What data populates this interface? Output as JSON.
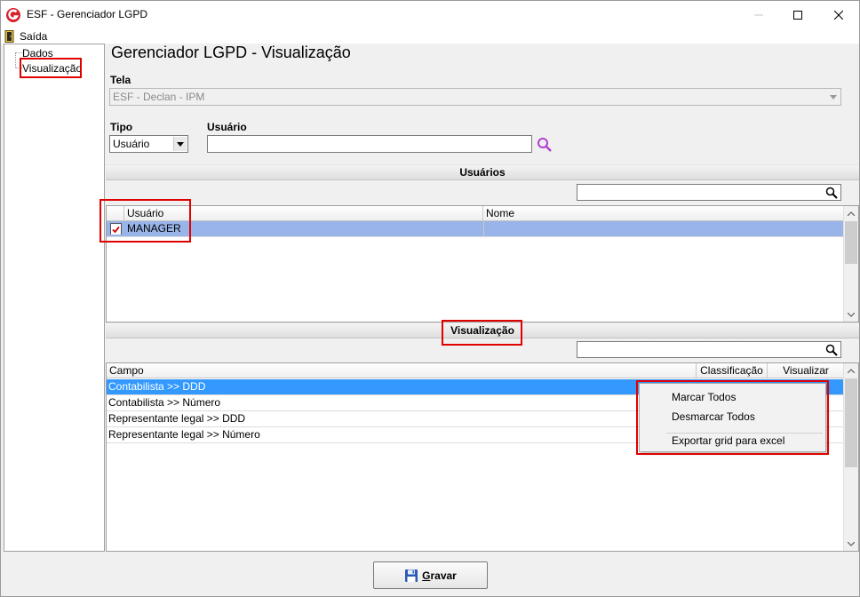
{
  "window": {
    "title": "ESF - Gerenciador LGPD",
    "controls": [
      "minimize",
      "maximize",
      "close"
    ]
  },
  "menu": {
    "items": [
      {
        "label": "Saída",
        "icon": "exit-door-icon"
      }
    ]
  },
  "tree": {
    "items": [
      {
        "label": "Dados"
      },
      {
        "label": "Visualização",
        "selected": true
      }
    ]
  },
  "page": {
    "title": "Gerenciador LGPD - Visualização",
    "tela_label": "Tela",
    "tela_value": "ESF - Declan - IPM",
    "tipo_label": "Tipo",
    "tipo_value": "Usuário",
    "usuario_label": "Usuário",
    "usuario_value": ""
  },
  "usuarios": {
    "section_title": "Usuários",
    "search_value": "",
    "columns": [
      "Usuário",
      "Nome"
    ],
    "rows": [
      {
        "checked": true,
        "usuario": "MANAGER",
        "nome": ""
      }
    ]
  },
  "visualizacao": {
    "section_title": "Visualização",
    "search_value": "",
    "columns": [
      "Campo",
      "Classificação",
      "Visualizar"
    ],
    "rows": [
      {
        "campo": "Contabilista >> DDD",
        "selected": true
      },
      {
        "campo": "Contabilista >> Número"
      },
      {
        "campo": "Representante legal >> DDD"
      },
      {
        "campo": "Representante legal >> Número"
      }
    ]
  },
  "context_menu": {
    "items": [
      "Marcar Todos",
      "Desmarcar Todos",
      "Exportar grid para excel"
    ]
  },
  "actions": {
    "save_label_underlined": "G",
    "save_label_rest": "ravar"
  },
  "colors": {
    "selected_row_user": "#99b4e8",
    "selected_row_field": "#3399ff",
    "highlight_box": "#e00000"
  }
}
